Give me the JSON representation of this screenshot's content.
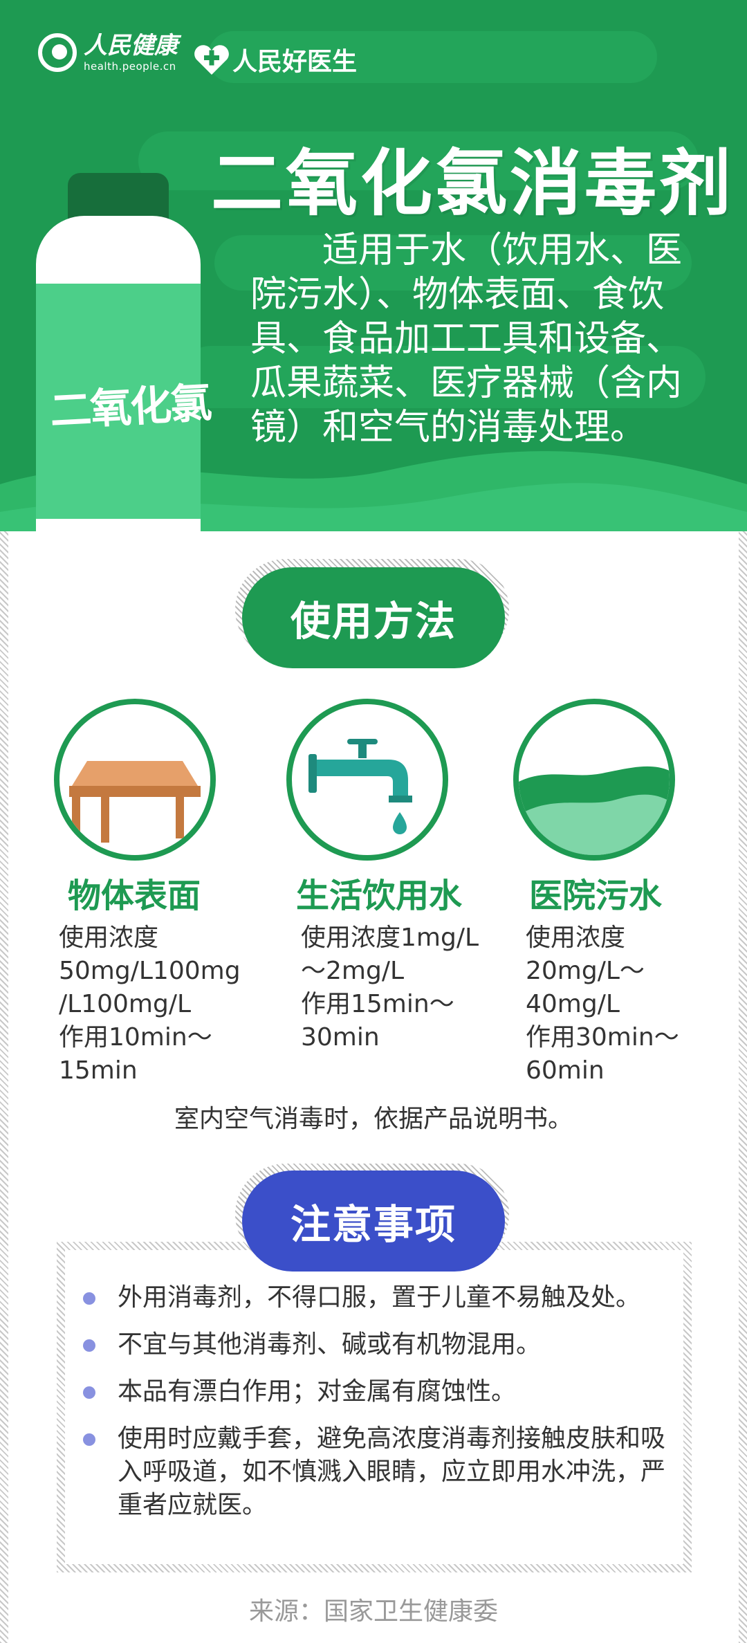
{
  "brand": {
    "logo1_cn": "人民健康",
    "logo1_en": "health.people.cn",
    "logo2_cn": "人民好医生"
  },
  "header": {
    "title": "二氧化氯消毒剂",
    "bottle_label": "二氧化氯",
    "intro": "适用于水（饮用水、医院污水）、物体表面、食饮具、食品加工工具和设备、瓜果蔬菜、医疗器械（含内镜）和空气的消毒处理。"
  },
  "usage": {
    "heading": "使用方法",
    "items": [
      {
        "name": "物体表面",
        "icon": "table-icon",
        "lines": [
          "使用浓度",
          "50mg/L100mg",
          "/L100mg/L",
          "作用10min～",
          "15min"
        ]
      },
      {
        "name": "生活饮用水",
        "icon": "faucet-icon",
        "lines": [
          "使用浓度1mg/L",
          "～2mg/L",
          "作用15min～",
          "30min"
        ]
      },
      {
        "name": "医院污水",
        "icon": "water-wave-icon",
        "lines": [
          "使用浓度",
          "20mg/L～",
          "40mg/L",
          "作用30min～",
          "60min"
        ]
      }
    ],
    "note": "室内空气消毒时，依据产品说明书。"
  },
  "caution": {
    "heading": "注意事项",
    "items": [
      "外用消毒剂，不得口服，置于儿童不易触及处。",
      "不宜与其他消毒剂、碱或有机物混用。",
      "本品有漂白作用；对金属有腐蚀性。",
      "使用时应戴手套，避免高浓度消毒剂接触皮肤和吸入呼吸道，如不慎溅入眼睛，应立即用水冲洗，严重者应就医。"
    ]
  },
  "source": "来源：国家卫生健康委",
  "colors": {
    "primary_green": "#1e9a52",
    "light_green": "#4ccf89",
    "dark_green": "#176e3b",
    "caution_blue": "#3b4fc9",
    "bullet": "#8891e0"
  }
}
